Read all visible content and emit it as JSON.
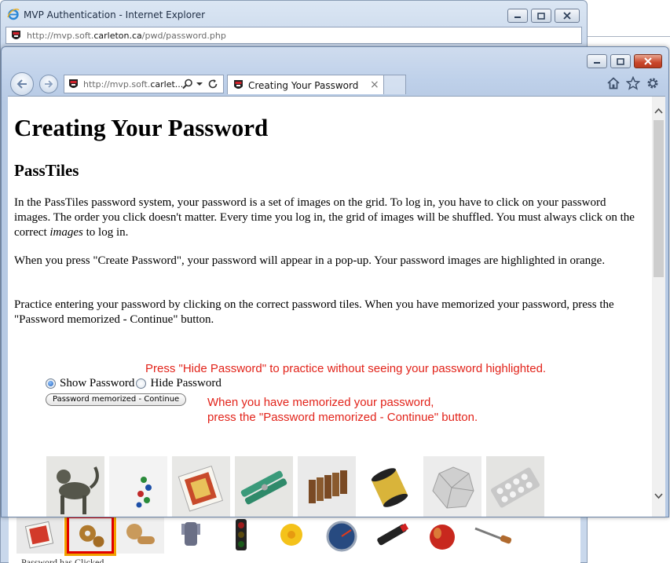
{
  "back_window": {
    "title": "MVP Authentication - Internet Explorer",
    "address": {
      "prefix": "http://mvp.soft.",
      "domain": "carleton.ca",
      "path": "/pwd/password.php"
    },
    "bottom_text": "Password has Clicked"
  },
  "front_window": {
    "address": {
      "prefix": "http://mvp.soft.",
      "domain": "carlet...",
      "search_icon": "magnifier-icon",
      "refresh_icon": "refresh-icon"
    },
    "tab": {
      "label": "Creating Your Password",
      "close": "×"
    },
    "toolbar_icons": [
      "home-icon",
      "star-icon",
      "gear-icon"
    ]
  },
  "page": {
    "title": "Creating Your Password",
    "subtitle": "PassTiles",
    "paragraphs": {
      "p1_before": "In the PassTiles password system, your password is a set of images on the grid. To log in, you have to click on your password images. The order you click doesn't matter. Every time you log in, the grid of images will be shuffled. You must always click on the correct ",
      "p1_em": "images",
      "p1_after": " to log in.",
      "p2": "When you press \"Create Password\", your password will appear in a pop-up. Your password images are highlighted in orange.",
      "p3": "Practice entering your password by clicking on the correct password tiles. When you have memorized your password, press the \"Password memorized - Continue\" button."
    },
    "notes": {
      "hide_hint": "Press \"Hide Password\" to practice without seeing your password highlighted.",
      "memorized_line1": "When you have memorized your password,",
      "memorized_line2": "press the \"Password memorized - Continue\" button."
    },
    "radios": {
      "show_label": "Show Password",
      "hide_label": "Hide Password",
      "selected": "Show Password"
    },
    "continue_button": "Password memorized - Continue",
    "tiles": [
      "monkey-statue",
      "marbles",
      "playing-cards",
      "green-clothespin",
      "dominoes",
      "gold-thread-spool",
      "crumpled-paper",
      "pill-blister-pack"
    ]
  },
  "back_tiles": [
    "playing-cards",
    "gears-highlighted",
    "wooden-pieces",
    "robot-hand",
    "traffic-light",
    "yellow-flower",
    "speedometer",
    "lighter",
    "apple",
    "corkscrew"
  ],
  "colors": {
    "note_red": "#e2231a",
    "highlight_orange": "#f0a000",
    "highlight_red": "#e00000"
  }
}
